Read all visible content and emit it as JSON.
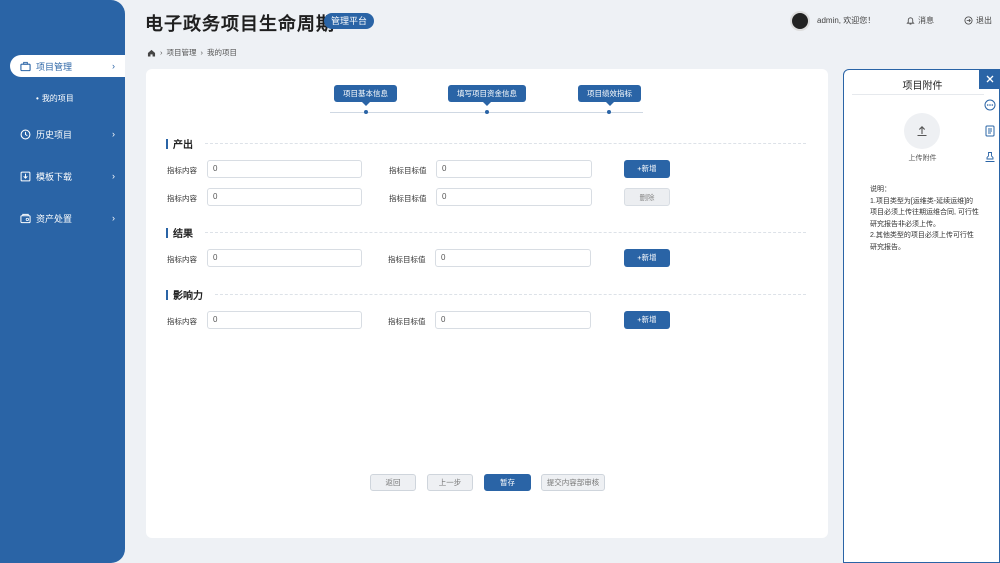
{
  "header": {
    "title": "电子政务项目生命周期",
    "badge": "管理平台",
    "user": "admin, 欢迎您！",
    "messages": "消息",
    "logout": "退出"
  },
  "sidebar": {
    "items": [
      {
        "label": "项目管理",
        "icon": "briefcase-icon"
      },
      {
        "label": "历史项目",
        "icon": "clock-icon"
      },
      {
        "label": "模板下载",
        "icon": "download-icon"
      },
      {
        "label": "资产处置",
        "icon": "asset-icon"
      }
    ],
    "sub_item": "我的项目"
  },
  "breadcrumb": [
    "项目管理",
    "我的项目"
  ],
  "steps": [
    "项目基本信息",
    "填写项目资金信息",
    "项目绩效指标"
  ],
  "sections": {
    "output": {
      "title": "产出",
      "rows": [
        {
          "label1": "指标内容",
          "value1": "0",
          "label2": "指标目标值",
          "value2": "0",
          "button": "+新增"
        },
        {
          "label1": "指标内容",
          "value1": "0",
          "label2": "指标目标值",
          "value2": "0",
          "button": "删除"
        }
      ]
    },
    "result": {
      "title": "结果",
      "rows": [
        {
          "label1": "指标内容",
          "value1": "0",
          "label2": "指标目标值",
          "value2": "0",
          "button": "+新增"
        }
      ]
    },
    "impact": {
      "title": "影响力",
      "rows": [
        {
          "label1": "指标内容",
          "value1": "0",
          "label2": "指标目标值",
          "value2": "0",
          "button": "+新增"
        }
      ]
    }
  },
  "footer": {
    "back": "返回",
    "prev": "上一步",
    "save": "暂存",
    "submit": "提交内容部审核"
  },
  "panel": {
    "title": "项目附件",
    "upload_label": "上传附件",
    "notes_title": "说明：",
    "note1": "1.项目类型为[运维类-延续运维]的项目必须上传往期运维合同, 可行性研究报告非必须上传。",
    "note2": "2.其他类型的项目必须上传可行性研究报告。"
  },
  "colors": {
    "primary": "#2a64a6"
  }
}
